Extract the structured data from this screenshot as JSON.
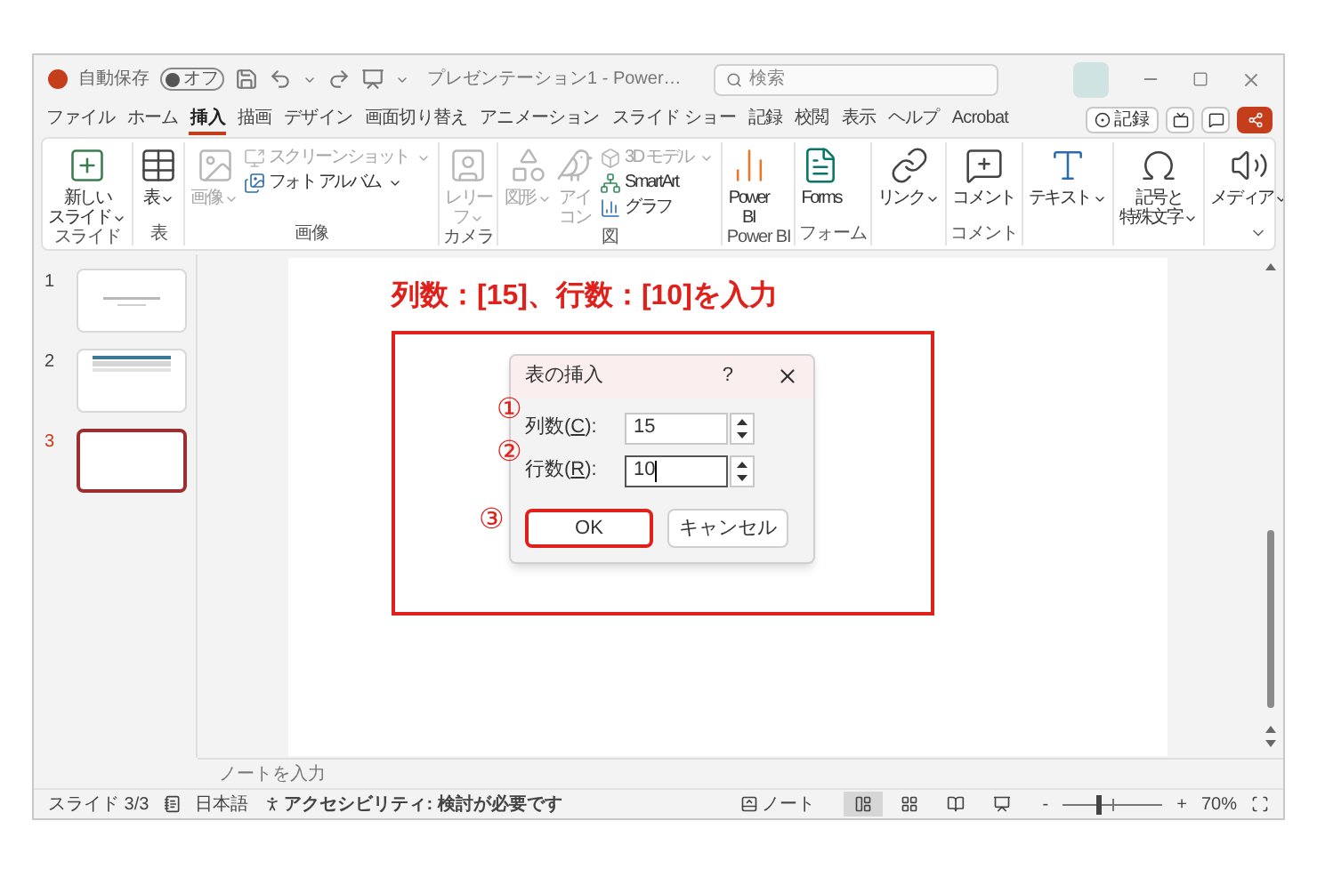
{
  "title_bar": {
    "autosave_label": "自動保存",
    "autosave": {
      "label": "オフ",
      "on": false
    },
    "document_title": "プレゼンテーション1 - Power…",
    "search": {
      "placeholder": "検索"
    }
  },
  "ribbon_tabs": [
    {
      "label": "ファイル",
      "selected": false
    },
    {
      "label": "ホーム",
      "selected": false
    },
    {
      "label": "挿入",
      "selected": true
    },
    {
      "label": "描画",
      "selected": false
    },
    {
      "label": "デザイン",
      "selected": false
    },
    {
      "label": "画面切り替え",
      "selected": false
    },
    {
      "label": "アニメーション",
      "selected": false
    },
    {
      "label": "スライド ショー",
      "selected": false
    },
    {
      "label": "記録",
      "selected": false
    },
    {
      "label": "校閲",
      "selected": false
    },
    {
      "label": "表示",
      "selected": false
    },
    {
      "label": "ヘルプ",
      "selected": false
    },
    {
      "label": "Acrobat",
      "selected": false
    }
  ],
  "record_button": {
    "label": "記録"
  },
  "ribbon_groups": [
    {
      "label": "スライド",
      "items": [
        {
          "kind": "large",
          "lines": [
            "新しい",
            "スライド"
          ],
          "dropdown": true,
          "disabled": false
        }
      ]
    },
    {
      "label": "表",
      "items": [
        {
          "kind": "large",
          "lines": [
            "表"
          ],
          "dropdown": true,
          "disabled": false
        }
      ]
    },
    {
      "label": "画像",
      "items": [
        {
          "kind": "large",
          "lines": [
            "画像"
          ],
          "dropdown": true,
          "disabled": true
        },
        {
          "kind": "small",
          "lines": [
            "スクリーンショット"
          ],
          "dropdown": true,
          "disabled": true
        },
        {
          "kind": "small",
          "lines": [
            "フォト アルバム"
          ],
          "dropdown": true,
          "disabled": false
        }
      ]
    },
    {
      "label": "カメラ",
      "items": [
        {
          "kind": "large",
          "lines": [
            "レリー",
            "フ"
          ],
          "dropdown": true,
          "disabled": true
        }
      ]
    },
    {
      "label": "図",
      "items": [
        {
          "kind": "large",
          "lines": [
            "図形"
          ],
          "dropdown": true,
          "disabled": true
        },
        {
          "kind": "large",
          "lines": [
            "アイ",
            "コン"
          ],
          "dropdown": false,
          "disabled": true
        },
        {
          "kind": "small",
          "lines": [
            "3D モデル"
          ],
          "dropdown": true,
          "disabled": true
        },
        {
          "kind": "small",
          "lines": [
            "SmartArt"
          ],
          "dropdown": false,
          "disabled": false
        },
        {
          "kind": "small",
          "lines": [
            "グラフ"
          ],
          "dropdown": false,
          "disabled": false
        }
      ]
    },
    {
      "label": "Power BI",
      "items": [
        {
          "kind": "large",
          "lines": [
            "Power",
            "BI"
          ],
          "dropdown": false,
          "disabled": false
        }
      ]
    },
    {
      "label": "フォーム",
      "items": [
        {
          "kind": "large",
          "lines": [
            "Forms"
          ],
          "dropdown": false,
          "disabled": false
        }
      ]
    },
    {
      "items": [
        {
          "kind": "large",
          "lines": [
            "リンク"
          ],
          "dropdown": true,
          "disabled": false
        }
      ]
    },
    {
      "label": "コメント",
      "items": [
        {
          "kind": "large",
          "lines": [
            "コメント"
          ],
          "dropdown": false,
          "disabled": false
        }
      ]
    },
    {
      "items": [
        {
          "kind": "large",
          "lines": [
            "テキスト"
          ],
          "dropdown": true,
          "disabled": false
        }
      ]
    },
    {
      "items": [
        {
          "kind": "large",
          "lines": [
            "記号と",
            "特殊文字"
          ],
          "dropdown": true,
          "disabled": false
        }
      ]
    },
    {
      "items": [
        {
          "kind": "large",
          "lines": [
            "メディア"
          ],
          "dropdown": true,
          "disabled": false
        }
      ]
    }
  ],
  "slides": [
    {
      "number": "1",
      "selected": false,
      "kind": "title"
    },
    {
      "number": "2",
      "selected": false,
      "kind": "banner"
    },
    {
      "number": "3",
      "selected": true,
      "kind": "blank"
    }
  ],
  "annotation": {
    "caption": "列数：[15]、行数：[10]を入力"
  },
  "dialog": {
    "title": "表の挿入",
    "help": "?",
    "fields": [
      {
        "step": "①",
        "label_start": "列数(",
        "access_key": "C",
        "label_end": "):",
        "value": "15",
        "focused": false
      },
      {
        "step": "②",
        "label_start": "行数(",
        "access_key": "R",
        "label_end": "):",
        "value": "10",
        "focused": true
      }
    ],
    "buttons": [
      {
        "label": "OK",
        "step": "③",
        "highlighted": true
      },
      {
        "label": "キャンセル",
        "highlighted": false
      }
    ]
  },
  "notes": {
    "placeholder": "ノートを入力"
  },
  "status_bar": {
    "slide_counter": "スライド 3/3",
    "language": "日本語",
    "accessibility": "アクセシビリティ: 検討が必要です",
    "notes_button": "ノート",
    "views": [
      {
        "selected": true
      },
      {
        "selected": false
      },
      {
        "selected": false
      },
      {
        "selected": false
      }
    ],
    "zoom": {
      "minus": "-",
      "plus": "+",
      "level": 0.36,
      "value": "70%"
    }
  }
}
